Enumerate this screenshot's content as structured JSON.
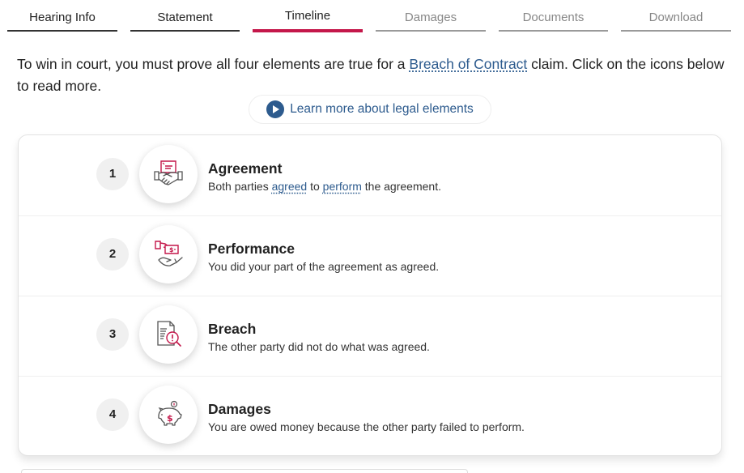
{
  "tabs": [
    {
      "label": "Hearing Info",
      "state": "done"
    },
    {
      "label": "Statement",
      "state": "done"
    },
    {
      "label": "Timeline",
      "state": "active"
    },
    {
      "label": "Damages",
      "state": "todo"
    },
    {
      "label": "Documents",
      "state": "todo"
    },
    {
      "label": "Download",
      "state": "todo"
    }
  ],
  "intro": {
    "before": "To win in court, you must prove all four elements are true for a ",
    "link": "Breach of Contract",
    "after": " claim. Click on the icons below to read more."
  },
  "learn_button": {
    "label": "Learn more about legal elements",
    "icon": "play-icon"
  },
  "elements": [
    {
      "number": "1",
      "title": "Agreement",
      "icon": "handshake-contract-icon",
      "desc_parts": [
        "Both parties ",
        "agreed",
        " to ",
        "perform",
        " the agreement."
      ]
    },
    {
      "number": "2",
      "title": "Performance",
      "icon": "hand-payment-icon",
      "desc": "You did your part of the agreement as agreed."
    },
    {
      "number": "3",
      "title": "Breach",
      "icon": "document-alert-search-icon",
      "desc": "The other party did not do what was agreed."
    },
    {
      "number": "4",
      "title": "Damages",
      "icon": "piggy-bank-icon",
      "desc": "You are owed money because the other party failed to perform."
    }
  ],
  "colors": {
    "accent": "#c4174a",
    "link": "#2d5b8e",
    "icon_stroke": "#555555"
  }
}
